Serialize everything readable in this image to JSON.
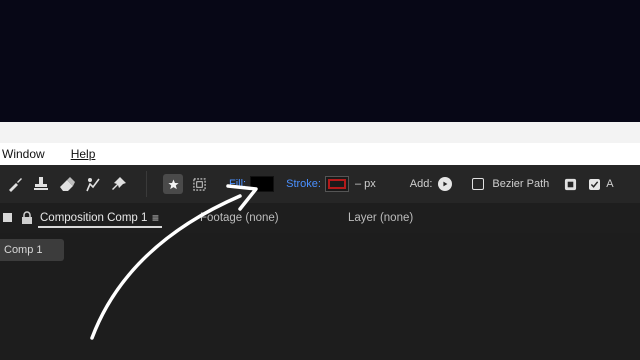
{
  "menubar": {
    "items": [
      {
        "label": "Window"
      },
      {
        "label": "Help"
      }
    ]
  },
  "toolbar": {
    "tools": [
      "brush-icon",
      "clone-stamp-icon",
      "eraser-icon",
      "roto-brush-icon",
      "puppet-pin-icon"
    ],
    "star_tool": "star-icon",
    "mask_tool": "mask-feather-icon",
    "fill_label": "Fill:",
    "fill_color": "#000000",
    "stroke_label": "Stroke:",
    "stroke_color": "#b31a1a",
    "stroke_value": "– px",
    "add_label": "Add:",
    "bezier_label": "Bezier Path",
    "bezier_checked": false,
    "truncated_label": "A",
    "accent_color": "#4a90ff"
  },
  "panel": {
    "comp_title": "Composition Comp 1",
    "menu_glyph": "≡",
    "footage": "Footage (none)",
    "layer": "Layer (none)"
  },
  "viewer": {
    "tab_label": "Comp 1"
  }
}
